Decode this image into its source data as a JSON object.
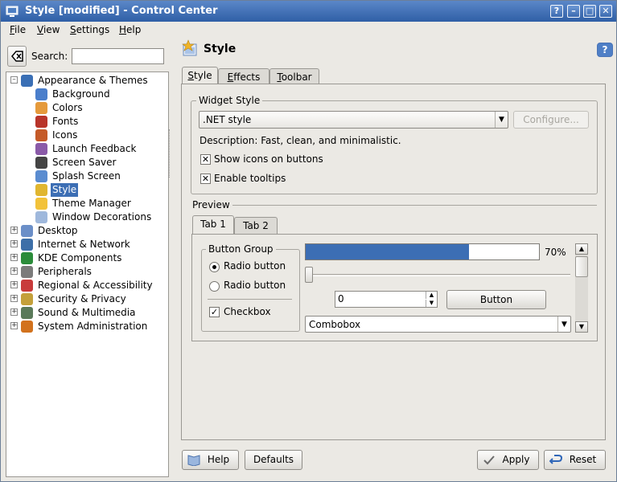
{
  "window": {
    "title": "Style [modified] - Control Center",
    "buttons": [
      "?",
      "–",
      "□",
      "✕"
    ]
  },
  "menubar": {
    "items": [
      {
        "label": "File",
        "mnemonic": "F"
      },
      {
        "label": "View",
        "mnemonic": "V"
      },
      {
        "label": "Settings",
        "mnemonic": "S"
      },
      {
        "label": "Help",
        "mnemonic": "H"
      }
    ]
  },
  "search": {
    "label": "Search:",
    "value": ""
  },
  "tree": {
    "items": [
      {
        "label": "Appearance & Themes",
        "expander": "–",
        "icon": "appearance-icon",
        "color": "#3a6fb5"
      },
      {
        "label": "Background",
        "icon": "background-icon",
        "color": "#4a7ecb"
      },
      {
        "label": "Colors",
        "icon": "colors-icon",
        "color": "#e59a3c"
      },
      {
        "label": "Fonts",
        "icon": "fonts-icon",
        "color": "#b8342a"
      },
      {
        "label": "Icons",
        "icon": "icons-icon",
        "color": "#c55a28"
      },
      {
        "label": "Launch Feedback",
        "icon": "launch-feedback-icon",
        "color": "#8a5aa8"
      },
      {
        "label": "Screen Saver",
        "icon": "screensaver-icon",
        "color": "#444444"
      },
      {
        "label": "Splash Screen",
        "icon": "splash-icon",
        "color": "#5a8cd0"
      },
      {
        "label": "Style",
        "icon": "style-icon",
        "color": "#e0b630",
        "selected": true
      },
      {
        "label": "Theme Manager",
        "icon": "theme-manager-icon",
        "color": "#f2c23a"
      },
      {
        "label": "Window Decorations",
        "icon": "window-decorations-icon",
        "color": "#9fb8dc"
      },
      {
        "label": "Desktop",
        "expander": "+",
        "icon": "desktop-icon",
        "color": "#6b8fc8"
      },
      {
        "label": "Internet & Network",
        "expander": "+",
        "icon": "internet-icon",
        "color": "#3d6fa8"
      },
      {
        "label": "KDE Components",
        "expander": "+",
        "icon": "kde-components-icon",
        "color": "#2b8c3a"
      },
      {
        "label": "Peripherals",
        "expander": "+",
        "icon": "peripherals-icon",
        "color": "#7b7b7b"
      },
      {
        "label": "Regional & Accessibility",
        "expander": "+",
        "icon": "regional-icon",
        "color": "#c83b3b"
      },
      {
        "label": "Security & Privacy",
        "expander": "+",
        "icon": "security-icon",
        "color": "#c4a03a"
      },
      {
        "label": "Sound & Multimedia",
        "expander": "+",
        "icon": "sound-icon",
        "color": "#5a7a5a"
      },
      {
        "label": "System Administration",
        "expander": "+",
        "icon": "sysadmin-icon",
        "color": "#d2721d"
      }
    ]
  },
  "module": {
    "title": "Style",
    "help_glyph": "?"
  },
  "tabs": [
    {
      "label": "Style",
      "mnemonic": "S",
      "active": true
    },
    {
      "label": "Effects",
      "mnemonic": "E"
    },
    {
      "label": "Toolbar",
      "mnemonic": "T"
    }
  ],
  "widget_style": {
    "group_title": "Widget Style",
    "combo_value": ".NET style",
    "configure_label": "Configure...",
    "description": "Description: Fast, clean, and minimalistic.",
    "show_icons_label": "Show icons on buttons",
    "show_icons_checked": true,
    "tooltips_label": "Enable tooltips",
    "tooltips_checked": true
  },
  "preview": {
    "title": "Preview",
    "tabs": [
      {
        "label": "Tab 1",
        "active": true
      },
      {
        "label": "Tab 2"
      }
    ],
    "button_group_title": "Button Group",
    "radio1_label": "Radio button",
    "radio2_label": "Radio button",
    "checkbox_label": "Checkbox",
    "progress_percent": 70,
    "progress_text": "70%",
    "spin_value": "0",
    "button_label": "Button",
    "combo_value": "Combobox"
  },
  "bottom": {
    "help": "Help",
    "defaults": "Defaults",
    "apply": "Apply",
    "reset": "Reset"
  },
  "colors": {
    "accent": "#3c6eb4",
    "titlebar": "#3f6fb5"
  }
}
